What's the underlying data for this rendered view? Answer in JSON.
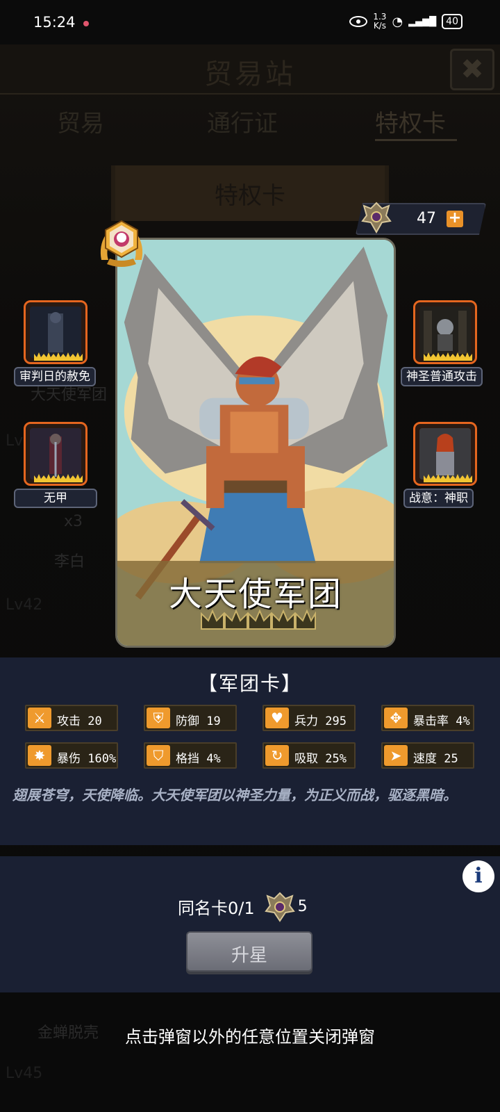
{
  "status_bar": {
    "time": "15:24",
    "net_speed_value": "1.3",
    "net_speed_unit": "K/s",
    "battery": "40"
  },
  "header": {
    "title": "贸易站"
  },
  "tabs": [
    {
      "label": "贸易"
    },
    {
      "label": "通行证"
    },
    {
      "label": "特权卡"
    }
  ],
  "section_banner": {
    "title": "特权卡"
  },
  "background_labels": {
    "card_name_behind": "大天使军团",
    "count": "x3",
    "hero_name": "李白",
    "lv_a": "Lv",
    "lv_42": "Lv42",
    "lv_45": "Lv45",
    "bottom_item": "金蝉脱壳"
  },
  "currency": {
    "amount": "47",
    "add_label": "+"
  },
  "card": {
    "name": "大天使军团",
    "stars": 5,
    "type": "【军团卡】"
  },
  "skills": [
    {
      "label": "审判日的赦免",
      "side": "left"
    },
    {
      "label": "无甲",
      "side": "left"
    },
    {
      "label": "神圣普通攻击",
      "side": "right"
    },
    {
      "label": "战意：神职",
      "side": "right"
    }
  ],
  "stats": [
    {
      "label": "攻击 20",
      "icon": "sword-icon"
    },
    {
      "label": "防御 19",
      "icon": "shield-icon"
    },
    {
      "label": "兵力 295",
      "icon": "heart-icon"
    },
    {
      "label": "暴击率 4%",
      "icon": "crosshair-icon"
    },
    {
      "label": "暴伤 160%",
      "icon": "burst-icon"
    },
    {
      "label": "格挡 4%",
      "icon": "block-icon"
    },
    {
      "label": "吸取 25%",
      "icon": "drain-icon"
    },
    {
      "label": "速度 25",
      "icon": "boot-icon"
    }
  ],
  "description": "翅展苍穹，天使降临。大天使军团以神圣力量，为正义而战，驱逐黑暗。",
  "upgrade": {
    "duplicate_label": "同名卡0/1",
    "cost": "5",
    "button_label": "升星"
  },
  "close_hint": "点击弹窗以外的任意位置关闭弹窗",
  "colors": {
    "accent_orange": "#ef9a2d",
    "panel_bg": "#1a2033",
    "skill_frame": "#e5661f"
  }
}
